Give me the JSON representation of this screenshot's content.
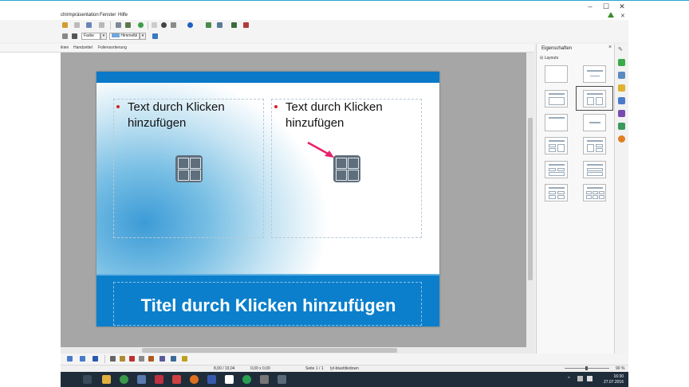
{
  "menu": {
    "items": [
      "chirmpräsentation",
      "Fenster",
      "Hilfe"
    ]
  },
  "format_bar": {
    "fill_label": "Farbe",
    "color_label": "Himmelbl"
  },
  "view_tabs": [
    "ikien",
    "Handzettel",
    "Foliensortierung"
  ],
  "slide": {
    "left_placeholder": "Text durch Klicken hinzufügen",
    "right_placeholder": "Text durch Klicken hinzufügen",
    "title_placeholder": "Titel durch Klicken hinzufügen"
  },
  "sidebar": {
    "title": "Eigenschaften",
    "close": "×",
    "section": "Layouts",
    "collapse": "⊟"
  },
  "status": {
    "position": "8,00 / 19,04",
    "size": "0,00 x 0,00",
    "slide": "Seite 1 / 1",
    "master": "lyt-bluetitledown",
    "zoom": "90 %"
  },
  "taskbar": {
    "time": "16:30",
    "date": "27.07.2016"
  },
  "colors": {
    "accent": "#0b7fcc",
    "bullet": "#d3241f",
    "arrow": "#e8206a"
  }
}
